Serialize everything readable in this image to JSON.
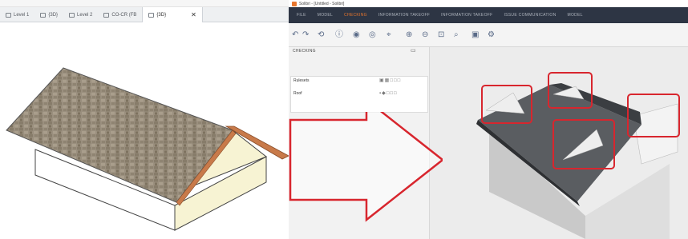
{
  "revit": {
    "tabs": [
      {
        "label": "Level 1",
        "icon": "plan-view-icon"
      },
      {
        "label": "{3D}",
        "icon": "view-3d-icon"
      },
      {
        "label": "Level 2",
        "icon": "plan-view-icon"
      },
      {
        "label": "CO-CR (FB",
        "icon": "plan-view-icon"
      },
      {
        "label": "{3D}",
        "icon": "view-3d-icon",
        "active": true
      }
    ],
    "close_symbol": "✕"
  },
  "solibri": {
    "window_title": "Solibri - [Untitled - Solibri]",
    "nav": [
      "FILE",
      "MODEL",
      "CHECKING",
      "INFORMATION TAKEOFF",
      "INFORMATION TAKEOFF",
      "ISSUE COMMUNICATION",
      "MODEL"
    ],
    "active_nav_index": 2,
    "toolbar_icons": [
      "undo-icon",
      "redo-icon",
      "orbit-icon",
      "info-icon",
      "visibility-icon",
      "hide-icon",
      "select-icon",
      "zoom-in-icon",
      "zoom-out-icon",
      "zoom-fit-icon",
      "measure-icon",
      "screenshot-icon",
      "settings-icon"
    ],
    "sidebar": {
      "title": "CHECKING",
      "rows": [
        {
          "label": "Rulesets"
        },
        {
          "label": "Roof"
        }
      ]
    },
    "view_tab": "3D"
  },
  "colors": {
    "highlight": "#d8262e",
    "arrow_outline": "#d8262e",
    "roof_shingle": "#9a8f7e",
    "fascia": "#c87a4a",
    "solibri_nav": "#2d3544",
    "accent": "#e8762d"
  }
}
